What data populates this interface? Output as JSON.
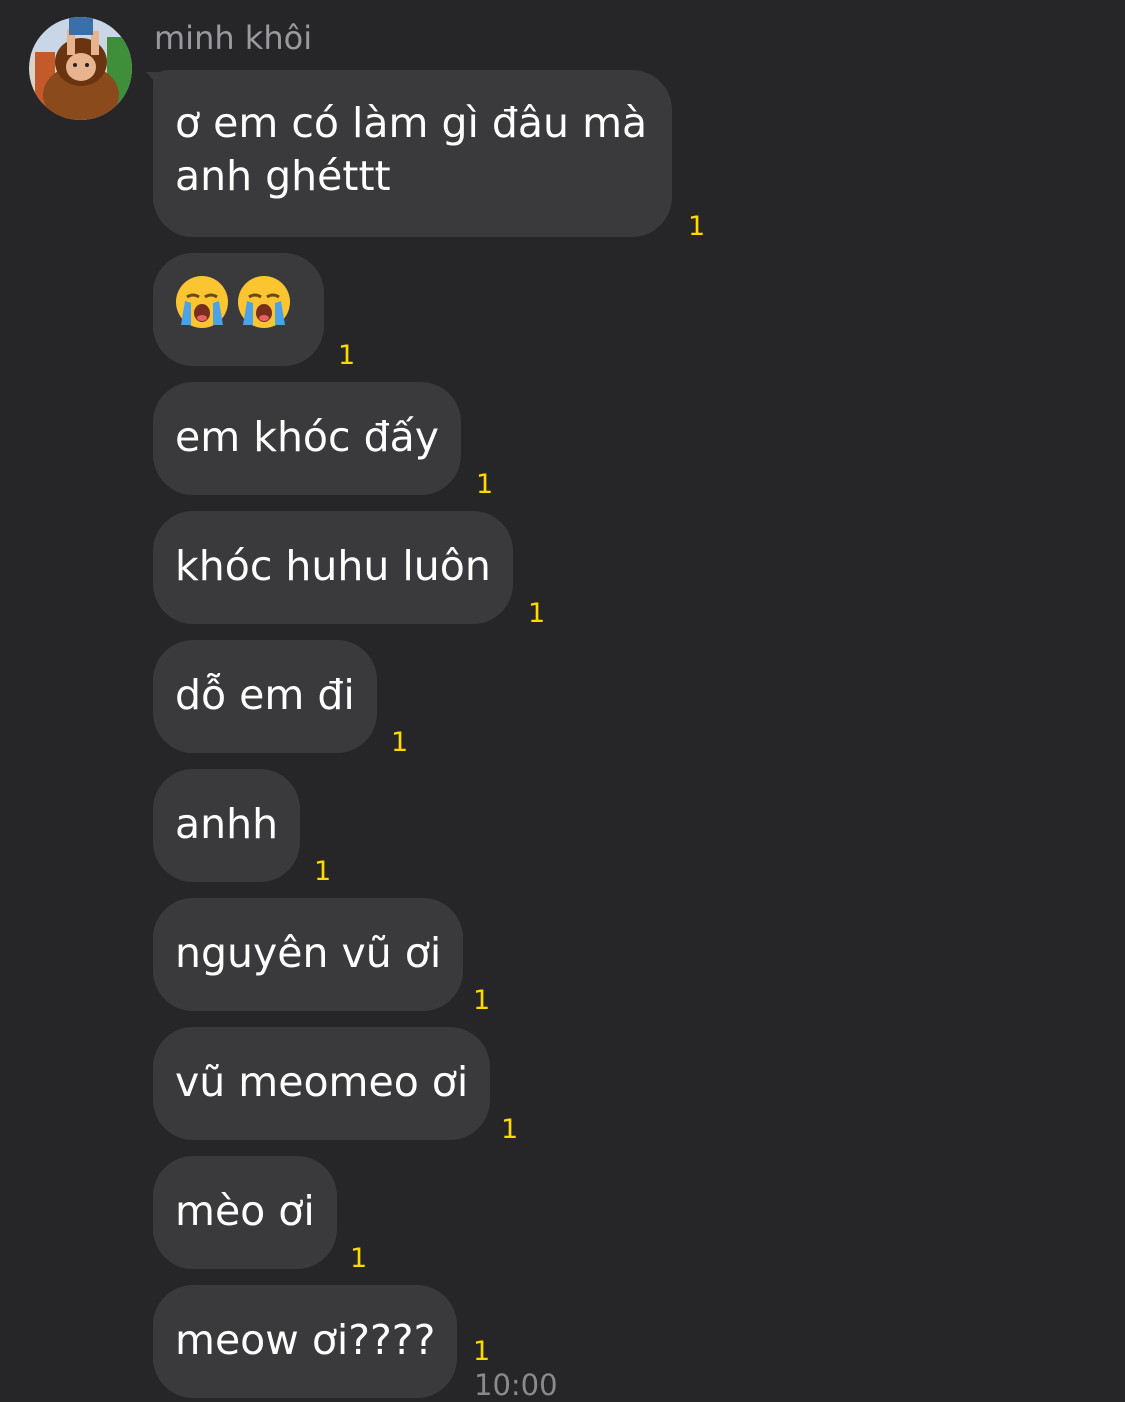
{
  "sender": {
    "name": "minh khôi",
    "avatar_icon": "profile-photo-avatar"
  },
  "messages": [
    {
      "text": "ơ em có làm gì đâu mà anh ghéttt",
      "read_count": "1"
    },
    {
      "text": "",
      "emojis": [
        "loudly-crying-face-icon",
        "loudly-crying-face-icon"
      ],
      "read_count": "1"
    },
    {
      "text": "em khóc đấy",
      "read_count": "1"
    },
    {
      "text": "khóc huhu luôn",
      "read_count": "1"
    },
    {
      "text": "dỗ em đi",
      "read_count": "1"
    },
    {
      "text": "anhh",
      "read_count": "1"
    },
    {
      "text": "nguyên vũ ơi",
      "read_count": "1"
    },
    {
      "text": "vũ meomeo ơi",
      "read_count": "1"
    },
    {
      "text": "mèo ơi",
      "read_count": "1"
    },
    {
      "text": "meow ơi????",
      "read_count": "1"
    }
  ],
  "timestamp": "10:00",
  "colors": {
    "background": "#262628",
    "bubble": "#3a3a3c",
    "read_indicator": "#ffd900",
    "sender_name": "#9a9a9e"
  }
}
